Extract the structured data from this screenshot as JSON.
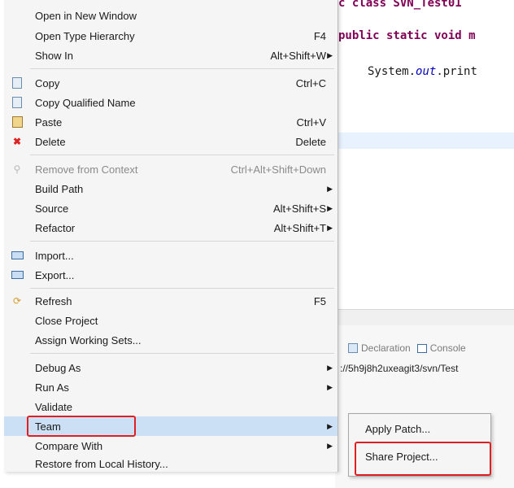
{
  "editor": {
    "line1": "c class SVN_Test01",
    "line2_kw": "public static void",
    "line2_rest": " m",
    "line3_pre": "System.",
    "line3_field": "out",
    "line3_post": ".print"
  },
  "views": {
    "declaration_tab": "Declaration",
    "console_tab": "Console",
    "url": "://5h9j8h2uxeagit3/svn/Test"
  },
  "menu": {
    "items": [
      {
        "label": "Open in New Window",
        "accel": "",
        "submenu": false
      },
      {
        "label": "Open Type Hierarchy",
        "accel": "F4",
        "submenu": false
      },
      {
        "label": "Show In",
        "accel": "Alt+Shift+W",
        "submenu": true
      },
      {
        "label": "Copy",
        "accel": "Ctrl+C",
        "submenu": false,
        "icon": "copy-icon"
      },
      {
        "label": "Copy Qualified Name",
        "accel": "",
        "submenu": false,
        "icon": "copy-qualified-icon"
      },
      {
        "label": "Paste",
        "accel": "Ctrl+V",
        "submenu": false,
        "icon": "paste-icon"
      },
      {
        "label": "Delete",
        "accel": "Delete",
        "submenu": false,
        "icon": "delete-icon"
      },
      {
        "label": "Remove from Context",
        "accel": "Ctrl+Alt+Shift+Down",
        "submenu": false,
        "disabled": true,
        "icon": "remove-context-icon"
      },
      {
        "label": "Build Path",
        "accel": "",
        "submenu": true
      },
      {
        "label": "Source",
        "accel": "Alt+Shift+S",
        "submenu": true
      },
      {
        "label": "Refactor",
        "accel": "Alt+Shift+T",
        "submenu": true
      },
      {
        "label": "Import...",
        "accel": "",
        "submenu": false,
        "icon": "import-icon"
      },
      {
        "label": "Export...",
        "accel": "",
        "submenu": false,
        "icon": "export-icon"
      },
      {
        "label": "Refresh",
        "accel": "F5",
        "submenu": false,
        "icon": "refresh-icon"
      },
      {
        "label": "Close Project",
        "accel": "",
        "submenu": false
      },
      {
        "label": "Assign Working Sets...",
        "accel": "",
        "submenu": false
      },
      {
        "label": "Debug As",
        "accel": "",
        "submenu": true
      },
      {
        "label": "Run As",
        "accel": "",
        "submenu": true
      },
      {
        "label": "Validate",
        "accel": "",
        "submenu": false
      },
      {
        "label": "Team",
        "accel": "",
        "submenu": true,
        "selected": true
      },
      {
        "label": "Compare With",
        "accel": "",
        "submenu": true
      },
      {
        "label": "Restore from Local History...",
        "accel": "",
        "submenu": false
      }
    ]
  },
  "submenu": {
    "items": [
      {
        "label": "Apply Patch..."
      },
      {
        "label": "Share Project..."
      }
    ]
  },
  "colors": {
    "highlight_box": "#e02020",
    "selected_bg": "#cce0f5",
    "menu_bg": "#f5f5f5"
  }
}
